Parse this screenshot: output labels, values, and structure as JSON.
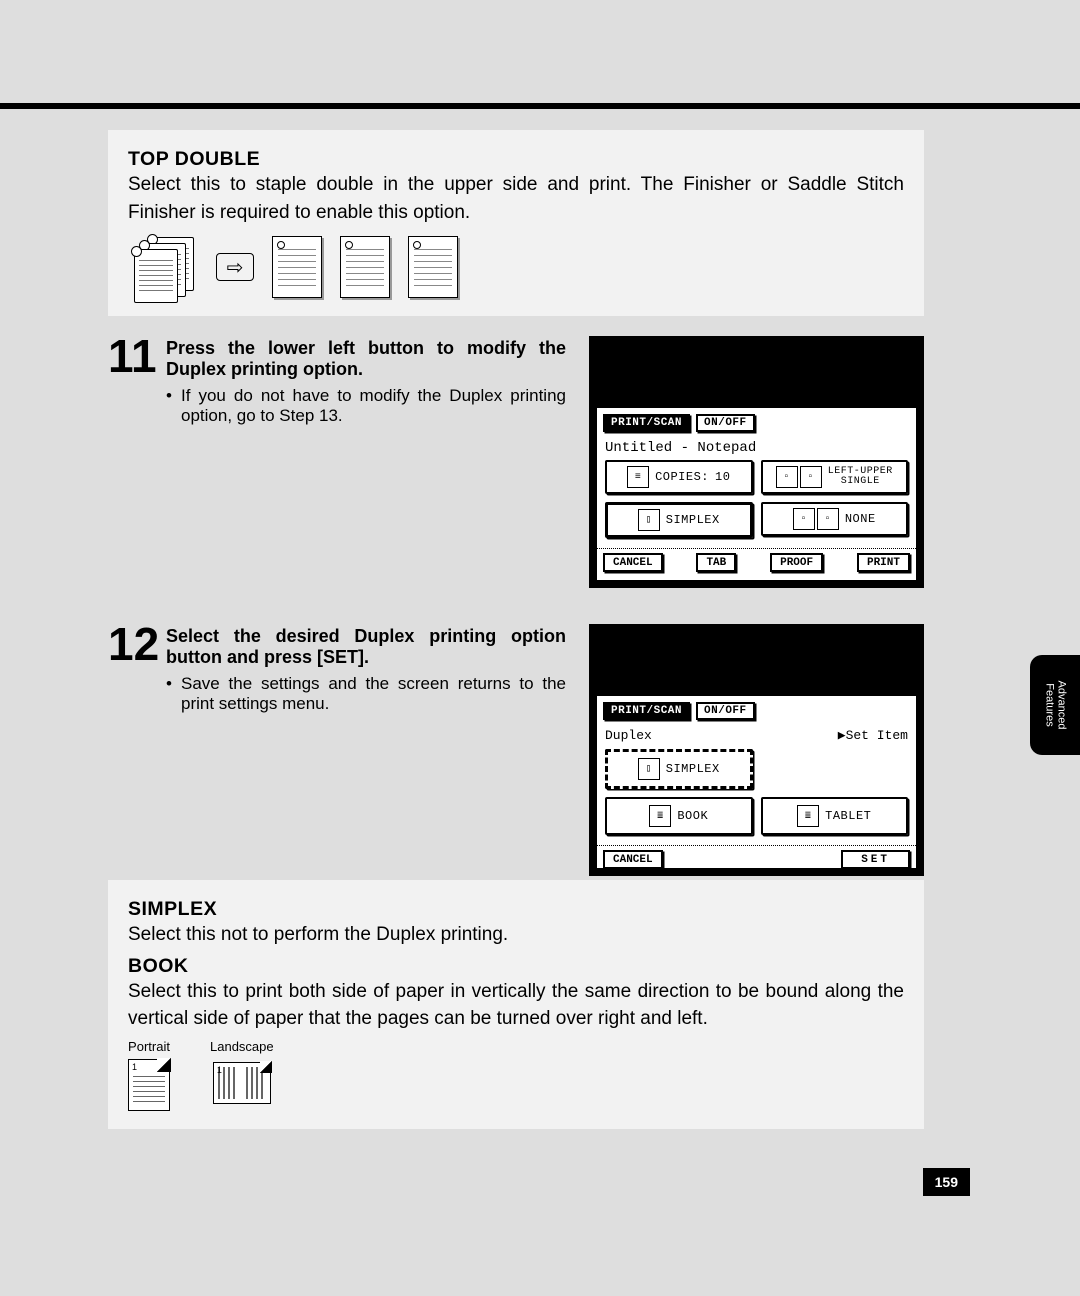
{
  "top_double": {
    "heading": "TOP DOUBLE",
    "text": "Select this to staple double in the upper side and print.  The Finisher or Saddle Stitch Finisher is required to enable this option."
  },
  "step11": {
    "number": "11",
    "title": "Press the lower left button to modify the Duplex printing option.",
    "bullet": "If you do not have to modify the Duplex printing option, go to Step 13."
  },
  "step12": {
    "number": "12",
    "title": "Select the desired Duplex printing option button and press [SET].",
    "bullet": "Save the settings and the screen returns to the print settings menu."
  },
  "lcd1": {
    "print_scan": "PRINT/SCAN",
    "onoff": "ON/OFF",
    "title": "Untitled - Notepad",
    "copies_label": "COPIES:",
    "copies_value": "10",
    "staple_value": "LEFT-UPPER\nSINGLE",
    "duplex_value": "SIMPLEX",
    "punch_value": "NONE",
    "footer": [
      "CANCEL",
      "TAB",
      "PROOF",
      "PRINT"
    ]
  },
  "lcd2": {
    "print_scan": "PRINT/SCAN",
    "onoff": "ON/OFF",
    "title_left": "Duplex",
    "title_right": "▶Set Item",
    "opt_simplex": "SIMPLEX",
    "opt_book": "BOOK",
    "opt_tablet": "TABLET",
    "footer_left": "CANCEL",
    "footer_right": "SET"
  },
  "defs": {
    "simplex_head": "SIMPLEX",
    "simplex_text": "Select this not to perform the Duplex printing.",
    "book_head": "BOOK",
    "book_text": "Select this to print both side of paper in vertically the same direction to be bound along the vertical side of paper that the pages can be turned over right and left.",
    "portrait": "Portrait",
    "landscape": "Landscape"
  },
  "side_tab": "Advanced\nFeatures",
  "page_number": "159"
}
